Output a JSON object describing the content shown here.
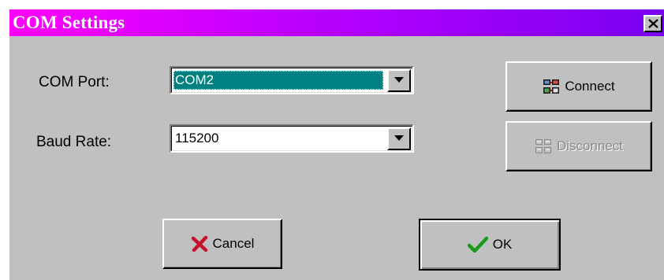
{
  "window": {
    "title": "COM Settings",
    "close_label": "Close"
  },
  "form": {
    "com_port": {
      "label": "COM Port:",
      "value": "COM2"
    },
    "baud_rate": {
      "label": "Baud Rate:",
      "value": "115200"
    }
  },
  "buttons": {
    "connect": {
      "label": "Connect",
      "icon": "connect-icon"
    },
    "disconnect": {
      "label": "Disconnect",
      "icon": "disconnect-icon",
      "enabled": false
    },
    "cancel": {
      "label": "Cancel",
      "icon": "red-x-icon"
    },
    "ok": {
      "label": "OK",
      "icon": "green-check-icon"
    }
  },
  "colors": {
    "title_gradient_start": "#ff00ff",
    "title_gradient_end": "#7a00f0",
    "dialog_face": "#c0c0c0",
    "selection": "#008080"
  }
}
